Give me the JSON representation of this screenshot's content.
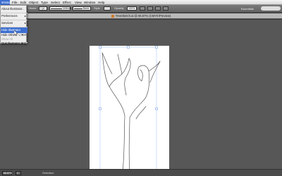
{
  "menubar": {
    "items": [
      {
        "label": "strator",
        "active": true
      },
      {
        "label": "File"
      },
      {
        "label": "Edit"
      },
      {
        "label": "Object"
      },
      {
        "label": "Type"
      },
      {
        "label": "Select"
      },
      {
        "label": "Effect"
      },
      {
        "label": "View"
      },
      {
        "label": "Window"
      },
      {
        "label": "Help"
      }
    ]
  },
  "controlbar": {
    "stroke_label": "Stroke",
    "stroke_value": "1 pt",
    "uniform_label": "Uniform",
    "brush_label": "Basic",
    "opacity_label": "Opacity",
    "opacity_value": "100%",
    "style_label": "Style",
    "workspace": "Essentials"
  },
  "document": {
    "title": "TreeSketch.ai @ 66.67% (CMYK/Preview)"
  },
  "app_menu": {
    "items": [
      {
        "label": "About Illustrator...",
        "shortcut": ""
      },
      {
        "label": "Preferences",
        "shortcut": "▸"
      },
      {
        "label": "Services",
        "shortcut": "▸"
      },
      {
        "label": "Hide Illustrator",
        "shortcut": "",
        "highlighted": true
      },
      {
        "label": "Hide Others",
        "shortcut": "⌥⌘H"
      },
      {
        "label": "Show All",
        "shortcut": "",
        "dim": true
      },
      {
        "label": "Quit Illustrator",
        "shortcut": "⌘Q"
      }
    ]
  },
  "statusbar": {
    "zoom": "66.67%",
    "artboard": "1",
    "tool": "Selection"
  },
  "colors": {
    "accent": "#3d6fd1",
    "canvas": "#575757",
    "artboard": "#ffffff"
  }
}
